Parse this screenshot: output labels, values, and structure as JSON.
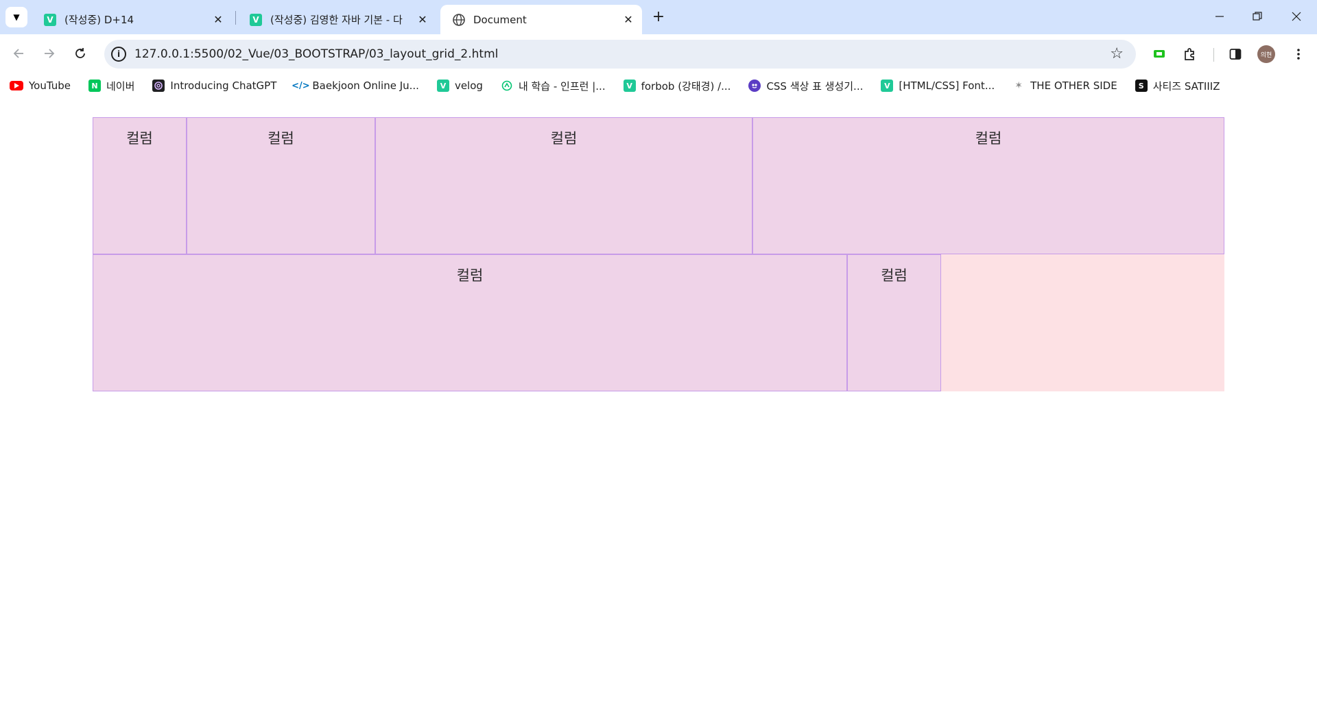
{
  "tabs": [
    {
      "title": "(작성중) D+14",
      "favicon": "V"
    },
    {
      "title": "(작성중) 김영한 자바 기본 - 다",
      "favicon": "V"
    },
    {
      "title": "Document",
      "favicon": "globe-icon"
    }
  ],
  "address_bar": {
    "url": "127.0.0.1:5500/02_Vue/03_BOOTSTRAP/03_layout_grid_2.html",
    "info": "i"
  },
  "profile": {
    "initials": "의현"
  },
  "bookmarks": [
    {
      "label": "YouTube",
      "icon": "youtube-icon",
      "color": "#ff0000"
    },
    {
      "label": "네이버",
      "icon": "naver-icon",
      "color": "#03c75a",
      "glyph": "N"
    },
    {
      "label": "Introducing ChatGPT",
      "icon": "chatgpt-icon",
      "color": "#202123"
    },
    {
      "label": "Baekjoon Online Ju...",
      "icon": "code-icon",
      "color": "#0076c0"
    },
    {
      "label": "velog",
      "icon": "velog-icon",
      "color": "#20c997",
      "glyph": "V"
    },
    {
      "label": "내 학습 - 인프런 |...",
      "icon": "inflearn-icon",
      "color": "#00c471"
    },
    {
      "label": "forbob (강태경) /...",
      "icon": "velog-icon",
      "color": "#20c997",
      "glyph": "V"
    },
    {
      "label": "CSS 색상 표 생성기...",
      "icon": "palette-icon",
      "color": "#5b3cc4"
    },
    {
      "label": "[HTML/CSS] Font...",
      "icon": "velog-icon",
      "color": "#20c997",
      "glyph": "V"
    },
    {
      "label": "THE OTHER SIDE",
      "icon": "theotherside-icon",
      "color": "#888888"
    },
    {
      "label": "사티즈 SATIIIZ",
      "icon": "satiiiz-icon",
      "color": "#111111",
      "glyph": "S"
    }
  ],
  "grid": {
    "row1": [
      "컬럼",
      "컬럼",
      "컬럼",
      "컬럼"
    ],
    "row2": [
      "컬럼",
      "컬럼"
    ]
  }
}
